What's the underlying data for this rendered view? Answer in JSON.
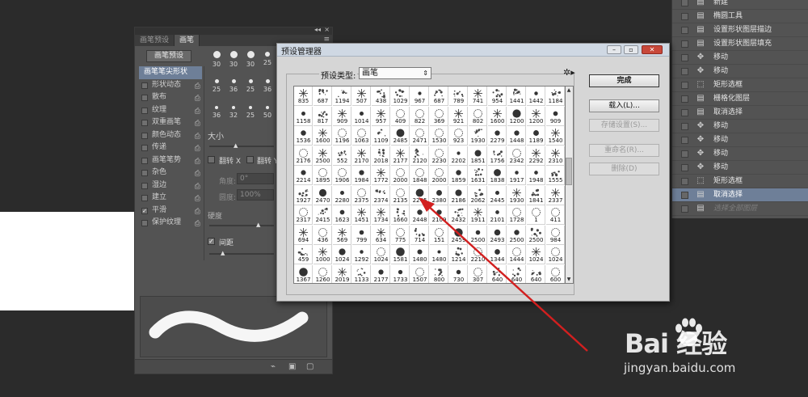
{
  "brush_panel": {
    "tabs": [
      "画笔预设",
      "画笔"
    ],
    "preset_button": "画笔预设",
    "items": [
      {
        "label": "画笔笔尖形状",
        "active": true,
        "checked": false,
        "lock": false
      },
      {
        "label": "形状动态",
        "active": false,
        "checked": false,
        "lock": true
      },
      {
        "label": "散布",
        "active": false,
        "checked": false,
        "lock": true
      },
      {
        "label": "纹理",
        "active": false,
        "checked": false,
        "lock": true
      },
      {
        "label": "双重画笔",
        "active": false,
        "checked": false,
        "lock": true
      },
      {
        "label": "颜色动态",
        "active": false,
        "checked": false,
        "lock": true
      },
      {
        "label": "传递",
        "active": false,
        "checked": false,
        "lock": true
      },
      {
        "label": "画笔笔势",
        "active": false,
        "checked": false,
        "lock": true
      },
      {
        "label": "杂色",
        "active": false,
        "checked": false,
        "lock": true
      },
      {
        "label": "湿边",
        "active": false,
        "checked": false,
        "lock": true
      },
      {
        "label": "建立",
        "active": false,
        "checked": false,
        "lock": true
      },
      {
        "label": "平滑",
        "active": false,
        "checked": true,
        "lock": true
      },
      {
        "label": "保护纹理",
        "active": false,
        "checked": false,
        "lock": true
      }
    ],
    "tip_sizes": [
      [
        "30",
        "30",
        "30",
        "25"
      ],
      [
        "25",
        "36",
        "25",
        "36"
      ],
      [
        "36",
        "32",
        "25",
        "50"
      ]
    ],
    "size_label": "大小",
    "flip_x": "翻转 X",
    "flip_y": "翻转 Y",
    "angle_label": "角度:",
    "angle_value": "0°",
    "roundness_label": "圆度:",
    "roundness_value": "100%",
    "hardness_label": "硬度",
    "spacing_label": "间距"
  },
  "history_panel": {
    "rows": [
      {
        "label": "新建",
        "icon": "document-icon",
        "state": "normal"
      },
      {
        "label": "椭圆工具",
        "icon": "document-icon",
        "state": "normal"
      },
      {
        "label": "设置形状图层描边",
        "icon": "document-icon",
        "state": "normal"
      },
      {
        "label": "设置形状图层填充",
        "icon": "document-icon",
        "state": "normal"
      },
      {
        "label": "移动",
        "icon": "move-icon",
        "state": "normal"
      },
      {
        "label": "移动",
        "icon": "move-icon",
        "state": "normal"
      },
      {
        "label": "矩形选框",
        "icon": "marquee-icon",
        "state": "normal"
      },
      {
        "label": "栅格化图层",
        "icon": "document-icon",
        "state": "normal"
      },
      {
        "label": "取消选择",
        "icon": "document-icon",
        "state": "normal"
      },
      {
        "label": "移动",
        "icon": "move-icon",
        "state": "normal"
      },
      {
        "label": "移动",
        "icon": "move-icon",
        "state": "normal"
      },
      {
        "label": "移动",
        "icon": "move-icon",
        "state": "normal"
      },
      {
        "label": "移动",
        "icon": "move-icon",
        "state": "normal"
      },
      {
        "label": "矩形选框",
        "icon": "marquee-icon",
        "state": "normal"
      },
      {
        "label": "取消选择",
        "icon": "document-icon",
        "state": "active"
      },
      {
        "label": "选择全部图层",
        "icon": "document-icon",
        "state": "disabled"
      }
    ]
  },
  "preset_manager": {
    "title": "预设管理器",
    "type_label": "预设类型:",
    "type_value": "画笔",
    "buttons": {
      "done": "完成",
      "load": "载入(L)...",
      "save": "存储设置(S)...",
      "rename": "重命名(R)...",
      "delete": "删除(D)"
    },
    "brush_sizes": [
      [
        "835",
        "687",
        "1194",
        "507",
        "438",
        "1029",
        "967",
        "687",
        "789",
        "741",
        "954",
        "1441",
        "1442",
        "1184"
      ],
      [
        "1158",
        "817",
        "909",
        "1014",
        "957",
        "409",
        "822",
        "369",
        "921",
        "802",
        "1600",
        "1200",
        "1200",
        "909"
      ],
      [
        "1536",
        "1600",
        "1196",
        "1063",
        "1109",
        "2485",
        "2471",
        "1530",
        "923",
        "1930",
        "2279",
        "1448",
        "1189",
        "1540"
      ],
      [
        "2176",
        "2500",
        "552",
        "2170",
        "2018",
        "2177",
        "2120",
        "2230",
        "2202",
        "1851",
        "1756",
        "2342",
        "2292",
        "2310"
      ],
      [
        "2214",
        "1895",
        "1906",
        "1984",
        "1772",
        "2000",
        "1848",
        "2000",
        "1859",
        "1631",
        "1838",
        "1917",
        "1948",
        "1555"
      ],
      [
        "1927",
        "2470",
        "2280",
        "2375",
        "2374",
        "2135",
        "2245",
        "2380",
        "2186",
        "2062",
        "2445",
        "1930",
        "1841",
        "2337"
      ],
      [
        "2317",
        "2415",
        "1623",
        "1451",
        "1734",
        "1660",
        "2448",
        "2109",
        "2432",
        "1911",
        "2101",
        "1728",
        "1",
        "411"
      ],
      [
        "694",
        "436",
        "569",
        "799",
        "634",
        "775",
        "714",
        "151",
        "2459",
        "2500",
        "2493",
        "2500",
        "2500",
        "984"
      ],
      [
        "459",
        "1000",
        "1024",
        "1292",
        "1024",
        "1581",
        "1480",
        "1480",
        "1214",
        "2210",
        "1344",
        "1444",
        "1024",
        "1024"
      ],
      [
        "1367",
        "1260",
        "2019",
        "1133",
        "2177",
        "1733",
        "1507",
        "800",
        "730",
        "307",
        "640",
        "640",
        "640",
        "600"
      ]
    ]
  },
  "watermark": {
    "logo": "Bai  经验",
    "url": "jingyan.baidu.com"
  },
  "colors": {
    "panel_bg": "#535353",
    "selection": "#6e7f98",
    "dialog_bg": "#d6d6d6",
    "arrow": "#d21f1f"
  }
}
